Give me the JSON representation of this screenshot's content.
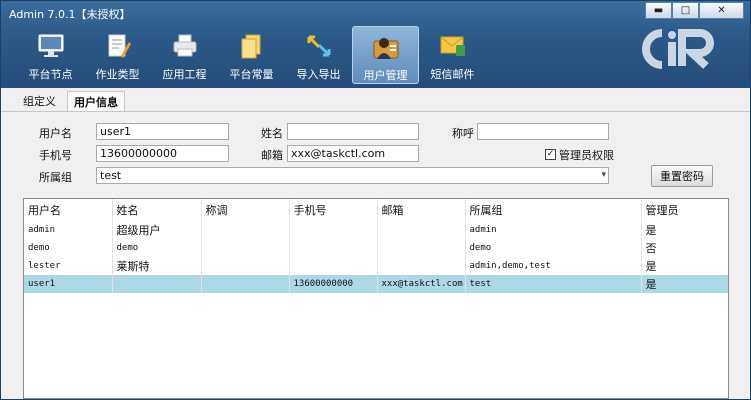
{
  "window": {
    "title": "Admin 7.0.1【未授权】",
    "controls": {
      "minimize": "▬",
      "maximize": "□",
      "close": "✕"
    }
  },
  "toolbar": {
    "items": [
      {
        "label": "平台节点",
        "icon": "monitor-icon"
      },
      {
        "label": "作业类型",
        "icon": "document-pencil-icon"
      },
      {
        "label": "应用工程",
        "icon": "printer-icon"
      },
      {
        "label": "平台常量",
        "icon": "documents-icon"
      },
      {
        "label": "导入导出",
        "icon": "import-export-arrows-icon"
      },
      {
        "label": "用户管理",
        "icon": "user-badge-icon",
        "active": true
      },
      {
        "label": "短信邮件",
        "icon": "envelope-icon"
      }
    ],
    "logo": "CiR"
  },
  "tabs": [
    {
      "label": "组定义"
    },
    {
      "label": "用户信息",
      "active": true
    }
  ],
  "form": {
    "username_label": "用户名",
    "username_value": "user1",
    "name_label": "姓名",
    "name_value": "",
    "title_label": "称呼",
    "title_value": "",
    "phone_label": "手机号",
    "phone_value": "13600000000",
    "email_label": "邮箱",
    "email_value": "xxx@taskctl.com",
    "admin_label": "管理员权限",
    "admin_checked": "✓",
    "group_label": "所属组",
    "group_value": "test",
    "reset_password": "重置密码"
  },
  "table": {
    "headers": [
      "用户名",
      "姓名",
      "称调",
      "手机号",
      "邮箱",
      "所属组",
      "管理员"
    ],
    "rows": [
      [
        "admin",
        "超级用户",
        "",
        "",
        "",
        "admin",
        "是"
      ],
      [
        "demo",
        "demo",
        "",
        "",
        "",
        "demo",
        "否"
      ],
      [
        "lester",
        "莱斯特",
        "",
        "",
        "",
        "admin,demo,test",
        "是"
      ],
      [
        "user1",
        "",
        "",
        "13600000000",
        "xxx@taskctl.com",
        "test",
        "是"
      ]
    ],
    "selected_row": 3
  },
  "colors": {
    "header_bg": "#2c5a88",
    "selection": "#add8e6",
    "active_tool": "#6f9bc8"
  }
}
